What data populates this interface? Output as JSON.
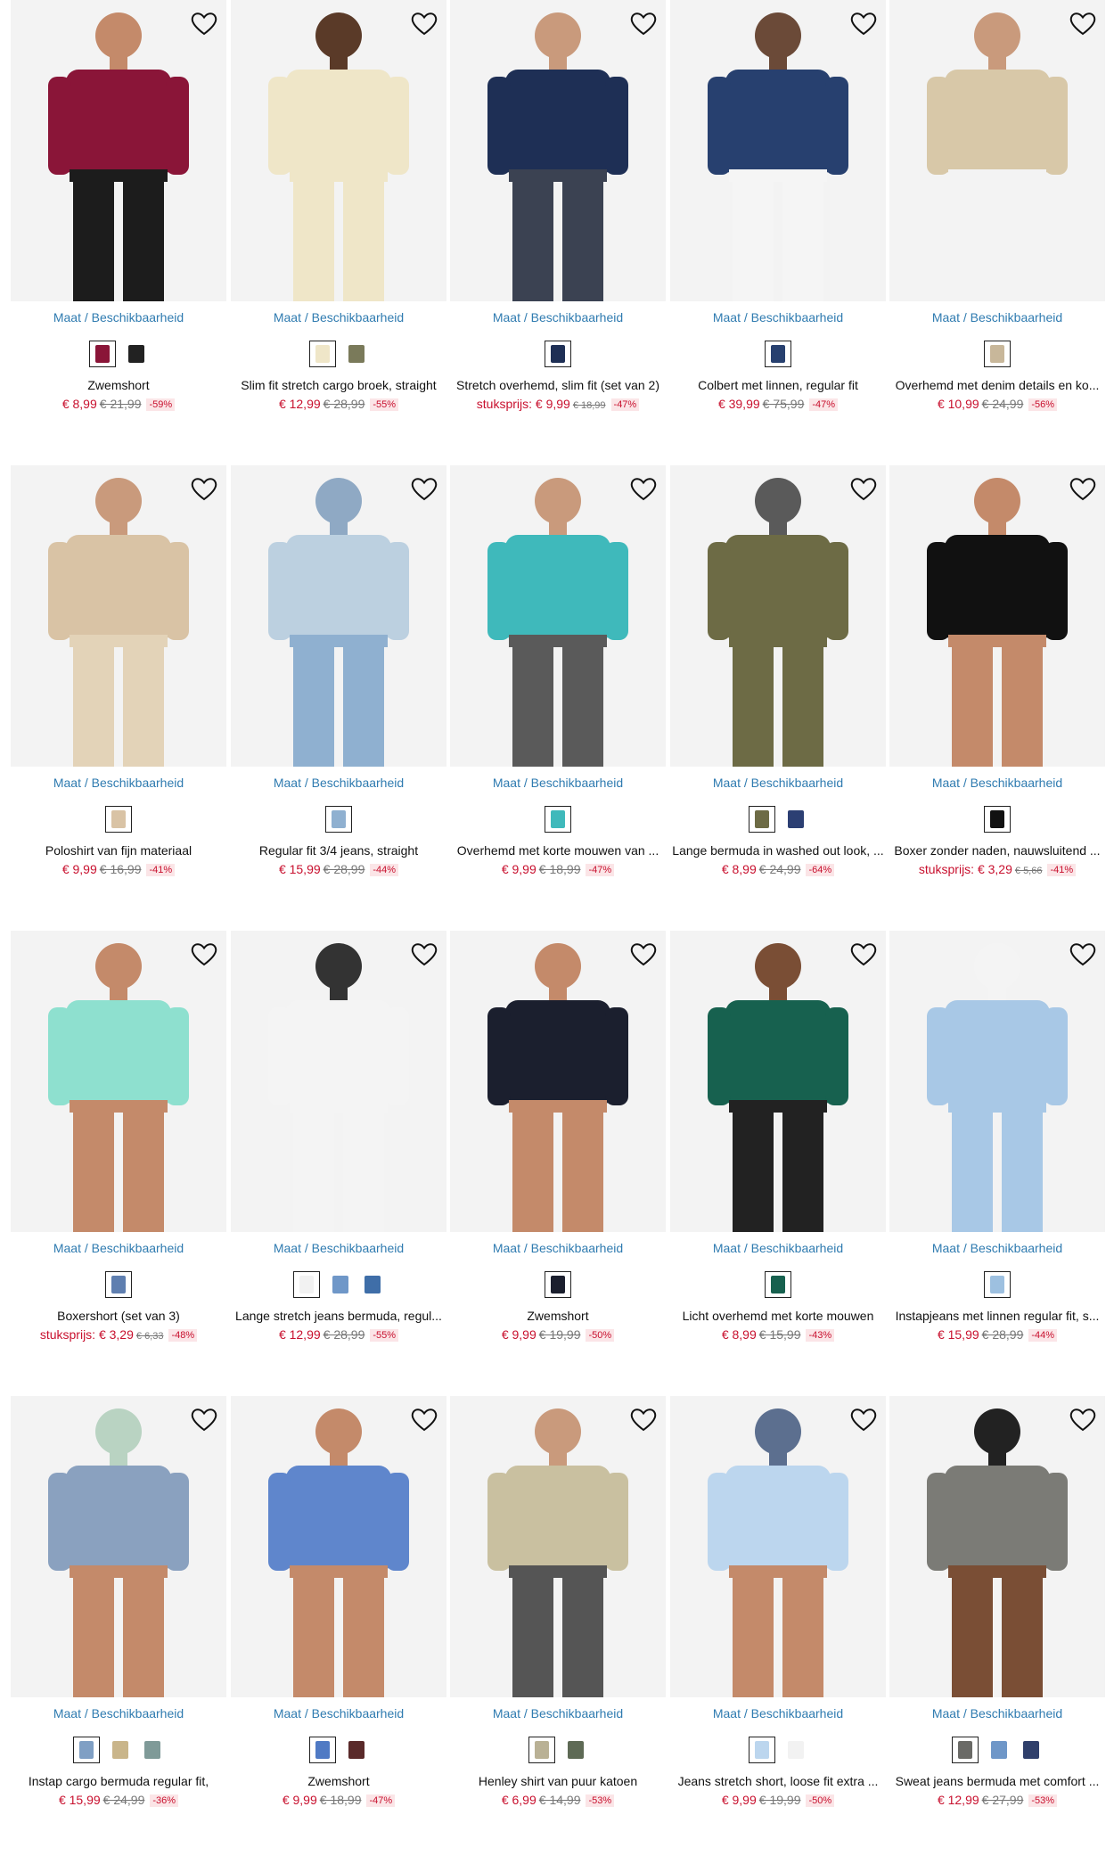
{
  "common": {
    "maat_label": "Maat / Beschikbaarheid"
  },
  "products": [
    {
      "name": "Zwemshort",
      "price": "€ 8,99",
      "old": "€ 21,99",
      "discount": "-59%",
      "unit": false,
      "swatches": [
        "#8a1538",
        "#222222"
      ],
      "colors": [
        "#c48a6a",
        "#8a1538",
        "#1c1c1c"
      ]
    },
    {
      "name": "Slim fit stretch cargo broek, straight",
      "price": "€ 12,99",
      "old": "€ 28,99",
      "discount": "-55%",
      "unit": false,
      "swatches": [
        "#efe6c8",
        "#7a7a5a"
      ],
      "colors": [
        "#5a3a28",
        "#efe6c8",
        "#efe6c8"
      ]
    },
    {
      "name": "Stretch overhemd, slim fit (set van 2)",
      "price": "€ 9,99",
      "old": "€ 18,99",
      "discount": "-47%",
      "unit": true,
      "unit_label": "stuksprijs:",
      "swatches": [
        "#1e2f55"
      ],
      "colors": [
        "#c99a7c",
        "#1e2f55",
        "#3b4252"
      ]
    },
    {
      "name": "Colbert met linnen, regular fit",
      "price": "€ 39,99",
      "old": "€ 75,99",
      "discount": "-47%",
      "unit": false,
      "swatches": [
        "#27406f"
      ],
      "colors": [
        "#6b4a38",
        "#27406f",
        "#f5f5f5"
      ]
    },
    {
      "name": "Overhemd met denim details en ko...",
      "price": "€ 10,99",
      "old": "€ 24,99",
      "discount": "-56%",
      "unit": false,
      "swatches": [
        "#c8b79a"
      ],
      "colors": [
        "#c99a7c",
        "#d8c8a8",
        "#f3f3f3"
      ]
    },
    {
      "name": "Poloshirt van fijn materiaal",
      "price": "€ 9,99",
      "old": "€ 16,99",
      "discount": "-41%",
      "unit": false,
      "swatches": [
        "#d9c3a5"
      ],
      "colors": [
        "#c99a7c",
        "#d9c3a5",
        "#e3d3b8"
      ]
    },
    {
      "name": "Regular fit 3/4 jeans, straight",
      "price": "€ 15,99",
      "old": "€ 28,99",
      "discount": "-44%",
      "unit": false,
      "swatches": [
        "#8fb0d0"
      ],
      "colors": [
        "#8fa9c4",
        "#bcd0e0",
        "#8fb0d0"
      ]
    },
    {
      "name": "Overhemd met korte mouwen van ...",
      "price": "€ 9,99",
      "old": "€ 18,99",
      "discount": "-47%",
      "unit": false,
      "swatches": [
        "#3fb9bb"
      ],
      "colors": [
        "#c99a7c",
        "#3fb9bb",
        "#5a5a5a"
      ]
    },
    {
      "name": "Lange bermuda in washed out look, ...",
      "price": "€ 8,99",
      "old": "€ 24,99",
      "discount": "-64%",
      "unit": false,
      "swatches": [
        "#6d6b45",
        "#2c3f73"
      ],
      "colors": [
        "#5a5a5a",
        "#6d6b45",
        "#6d6b45"
      ]
    },
    {
      "name": "Boxer zonder naden, nauwsluitend ...",
      "price": "€ 3,29",
      "old": "€ 5,66",
      "discount": "-41%",
      "unit": true,
      "unit_label": "stuksprijs:",
      "swatches": [
        "#111111"
      ],
      "colors": [
        "#c48a6a",
        "#111111",
        "#c48a6a"
      ]
    },
    {
      "name": "Boxershort (set van 3)",
      "price": "€ 3,29",
      "old": "€ 6,33",
      "discount": "-48%",
      "unit": true,
      "unit_label": "stuksprijs:",
      "swatches": [
        "#5f7fb0"
      ],
      "colors": [
        "#c48a6a",
        "#8ee0cf",
        "#c48a6a"
      ]
    },
    {
      "name": "Lange stretch jeans bermuda, regul...",
      "price": "€ 12,99",
      "old": "€ 28,99",
      "discount": "-55%",
      "unit": false,
      "swatches": [
        "#f2f2f2",
        "#6f97c8",
        "#3f6ea8"
      ],
      "colors": [
        "#333333",
        "#f4f4f4",
        "#f4f4f4"
      ]
    },
    {
      "name": "Zwemshort",
      "price": "€ 9,99",
      "old": "€ 19,99",
      "discount": "-50%",
      "unit": false,
      "swatches": [
        "#1b1f2e"
      ],
      "colors": [
        "#c48a6a",
        "#1b1f2e",
        "#c48a6a"
      ]
    },
    {
      "name": "Licht overhemd met korte mouwen",
      "price": "€ 8,99",
      "old": "€ 15,99",
      "discount": "-43%",
      "unit": false,
      "swatches": [
        "#17614f"
      ],
      "colors": [
        "#7a4e35",
        "#17614f",
        "#222222"
      ]
    },
    {
      "name": "Instapjeans met linnen regular fit, s...",
      "price": "€ 15,99",
      "old": "€ 28,99",
      "discount": "-44%",
      "unit": false,
      "swatches": [
        "#9dc0e0"
      ],
      "colors": [
        "#f4f4f4",
        "#a8c8e6",
        "#a8c8e6"
      ]
    },
    {
      "name": "Instap cargo bermuda regular fit,",
      "price": "€ 15,99",
      "old": "€ 24,99",
      "discount": "-36%",
      "unit": false,
      "swatches": [
        "#7f9fc4",
        "#c9b58a",
        "#7f9a98"
      ],
      "colors": [
        "#b9d3c2",
        "#8aa1bf",
        "#c48a6a"
      ]
    },
    {
      "name": "Zwemshort",
      "price": "€ 9,99",
      "old": "€ 18,99",
      "discount": "-47%",
      "unit": false,
      "swatches": [
        "#4f7ac4",
        "#5a2a2a"
      ],
      "colors": [
        "#c48a6a",
        "#5f86cc",
        "#c48a6a"
      ]
    },
    {
      "name": "Henley shirt van puur katoen",
      "price": "€ 6,99",
      "old": "€ 14,99",
      "discount": "-53%",
      "unit": false,
      "swatches": [
        "#b9b195",
        "#5e6a55"
      ],
      "colors": [
        "#c99a7c",
        "#c9c0a0",
        "#555555"
      ]
    },
    {
      "name": "Jeans stretch short, loose fit extra ...",
      "price": "€ 9,99",
      "old": "€ 19,99",
      "discount": "-50%",
      "unit": false,
      "swatches": [
        "#bcd6ee",
        "#f2f2f2"
      ],
      "colors": [
        "#5c6f8f",
        "#bcd6ee",
        "#c48a6a"
      ]
    },
    {
      "name": "Sweat jeans bermuda met comfort ...",
      "price": "€ 12,99",
      "old": "€ 27,99",
      "discount": "-53%",
      "unit": false,
      "swatches": [
        "#6a6a66",
        "#6f97c8",
        "#2f3f6b"
      ],
      "colors": [
        "#222222",
        "#7b7b76",
        "#7a4e35"
      ]
    }
  ]
}
